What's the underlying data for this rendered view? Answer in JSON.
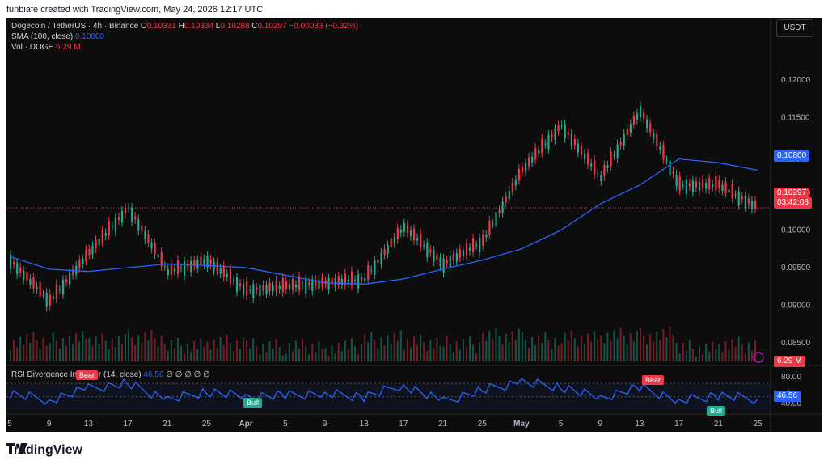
{
  "header": {
    "attribution": "funbiafe created with TradingView.com, May 24, 2026 12:17 UTC"
  },
  "legend": {
    "symbol": "Dogecoin / TetherUS · 4h · Binance",
    "o_label": "O",
    "o_value": "0.10331",
    "h_label": "H",
    "h_value": "0.10334",
    "l_label": "L",
    "l_value": "0.10288",
    "c_label": "C",
    "c_value": "0.10297",
    "change": "−0.00033 (−0.32%)",
    "sma_label": "SMA (100, close)",
    "sma_value": "0.10800",
    "vol_label": "Vol · DOGE",
    "vol_value": "6.29 M",
    "rsi_label": "RSI Divergence Indicator (14, close)",
    "rsi_value": "46.56",
    "rsi_extra": "∅ ∅ ∅ ∅ ∅"
  },
  "currency": "USDT",
  "price_axis": {
    "ticks": [
      "0.12000",
      "0.11500",
      "0.11000",
      "0.10500",
      "0.10000",
      "0.09500",
      "0.09000",
      "0.08500"
    ],
    "sma_tag": "0.10800",
    "last_price_tag": "0.10297",
    "countdown": "03:42:08",
    "vol_tag": "6.29 M"
  },
  "rsi_axis": {
    "ticks": [
      "80.00",
      "40.00"
    ],
    "value_tag": "46.56",
    "signals": [
      {
        "label": "Bear",
        "type": "bear"
      },
      {
        "label": "Bull",
        "type": "bull"
      },
      {
        "label": "Bear",
        "type": "bear"
      },
      {
        "label": "Bull",
        "type": "bull"
      }
    ]
  },
  "time_axis": {
    "labels": [
      "5",
      "9",
      "13",
      "17",
      "21",
      "25",
      "Apr",
      "5",
      "9",
      "13",
      "17",
      "21",
      "25",
      "May",
      "5",
      "9",
      "13",
      "17",
      "21",
      "25"
    ]
  },
  "footer": {
    "brand": "TradingView"
  },
  "colors": {
    "up": "#22ab94",
    "down": "#f23645",
    "sma": "#2962ff",
    "rsi": "#2962ff",
    "bg": "#0d0d0d"
  },
  "chart_data": {
    "type": "line",
    "title": "Dogecoin / TetherUS · 4h · Binance",
    "xlabel": "",
    "ylabel": "",
    "ylim": [
      0.0825,
      0.124
    ],
    "series": [
      {
        "name": "DOGE/USDT close",
        "x": [
          "Mar 5",
          "Mar 9",
          "Mar 13",
          "Mar 17",
          "Mar 21",
          "Mar 25",
          "Apr 1",
          "Apr 5",
          "Apr 9",
          "Apr 13",
          "Apr 17",
          "Apr 21",
          "Apr 25",
          "May 1",
          "May 5",
          "May 9",
          "May 13",
          "May 17",
          "May 21",
          "May 24"
        ],
        "values": [
          0.096,
          0.0905,
          0.097,
          0.103,
          0.0945,
          0.096,
          0.092,
          0.0925,
          0.093,
          0.0935,
          0.1005,
          0.0955,
          0.0985,
          0.108,
          0.114,
          0.107,
          0.116,
          0.106,
          0.106,
          0.103
        ]
      },
      {
        "name": "SMA (100, close)",
        "x": [
          "Mar 5",
          "Mar 9",
          "Mar 13",
          "Mar 17",
          "Mar 21",
          "Mar 25",
          "Apr 1",
          "Apr 5",
          "Apr 9",
          "Apr 13",
          "Apr 17",
          "Apr 21",
          "Apr 25",
          "May 1",
          "May 5",
          "May 9",
          "May 13",
          "May 17",
          "May 21",
          "May 24"
        ],
        "values": [
          0.0965,
          0.0948,
          0.0945,
          0.095,
          0.0955,
          0.0953,
          0.095,
          0.094,
          0.093,
          0.0928,
          0.0935,
          0.0948,
          0.096,
          0.0975,
          0.1,
          0.1035,
          0.106,
          0.1095,
          0.109,
          0.108
        ]
      },
      {
        "name": "RSI (14, close)",
        "x": [
          "Mar 5",
          "Mar 9",
          "Mar 13",
          "Mar 17",
          "Mar 21",
          "Mar 25",
          "Apr 1",
          "Apr 5",
          "Apr 9",
          "Apr 13",
          "Apr 17",
          "Apr 21",
          "Apr 25",
          "May 1",
          "May 5",
          "May 9",
          "May 13",
          "May 17",
          "May 21",
          "May 24"
        ],
        "values": [
          55,
          45,
          62,
          70,
          45,
          58,
          50,
          52,
          55,
          50,
          68,
          42,
          60,
          72,
          65,
          48,
          64,
          44,
          52,
          46.56
        ]
      }
    ]
  }
}
